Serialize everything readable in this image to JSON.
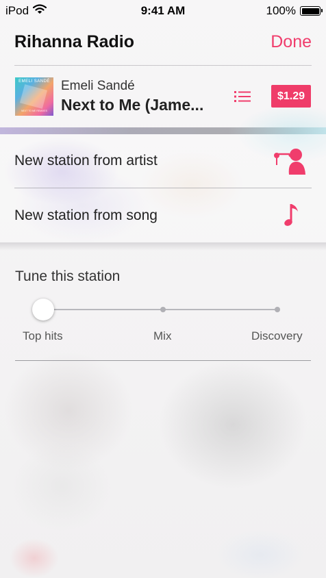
{
  "status_bar": {
    "device": "iPod",
    "time": "9:41 AM",
    "battery": "100%",
    "icons": [
      "wifi-icon",
      "battery-icon"
    ]
  },
  "header": {
    "title": "Rihanna Radio",
    "done_label": "Done"
  },
  "now_playing": {
    "artist": "Emeli Sandé",
    "title": "Next to Me (Jame...",
    "price": "$1.29",
    "album_art_text": "EMELI SANDÉ",
    "album_art_subtext": "NEXT TO ME REMIXES",
    "icons": [
      "album-art",
      "list-icon"
    ]
  },
  "menu": {
    "items": [
      {
        "label": "New station from artist",
        "icon": "singer-icon"
      },
      {
        "label": "New station from song",
        "icon": "music-note-icon"
      }
    ]
  },
  "tune": {
    "title": "Tune this station",
    "stops": [
      "Top hits",
      "Mix",
      "Discovery"
    ],
    "selected": "Top hits",
    "level": 0
  },
  "colors": {
    "accent": "#f03d6c",
    "price_bg": "#ef3c69"
  }
}
